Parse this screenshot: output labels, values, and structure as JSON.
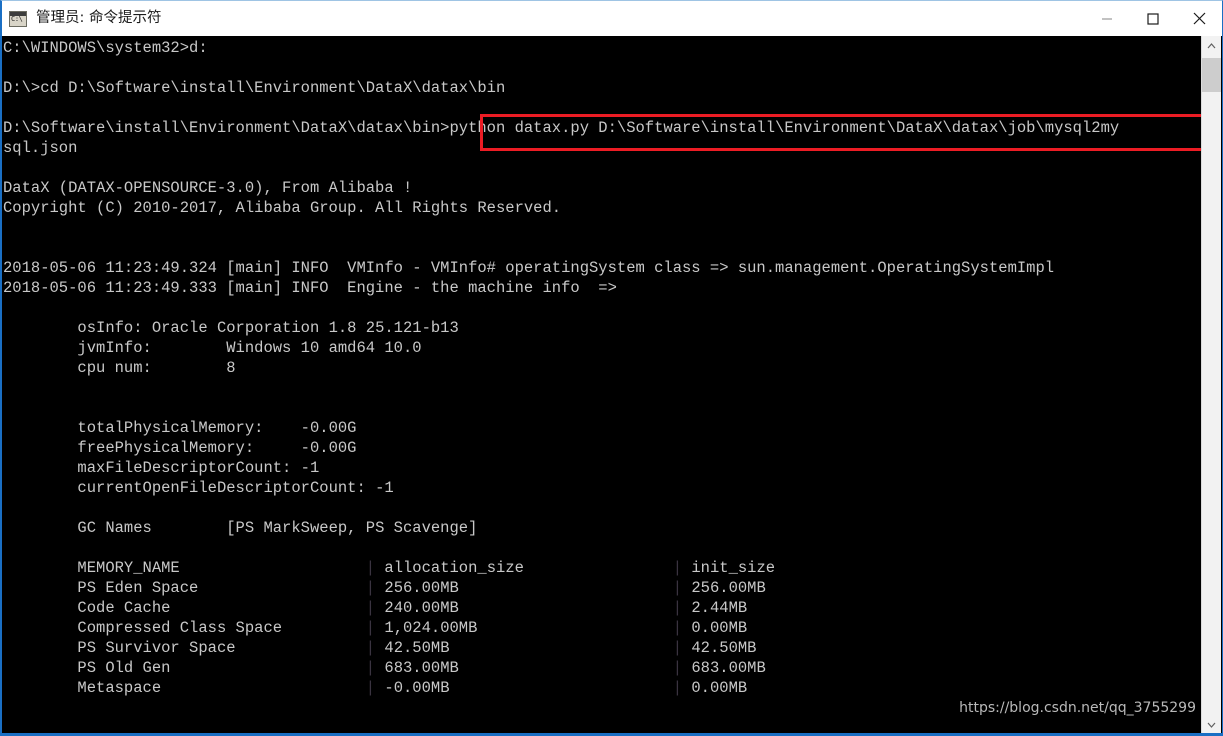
{
  "window": {
    "title": "管理员: 命令提示符",
    "icon": "console-icon",
    "icon_glyph": "C:\\",
    "controls": [
      {
        "name": "minimize",
        "label": "—"
      },
      {
        "name": "maximize",
        "label": "□"
      },
      {
        "name": "close",
        "label": "✕"
      }
    ]
  },
  "terminal": {
    "console_text": "C:\\WINDOWS\\system32>d:\n\nD:\\>cd D:\\Software\\install\\Environment\\DataX\\datax\\bin\n\nD:\\Software\\install\\Environment\\DataX\\datax\\bin>python datax.py D:\\Software\\install\\Environment\\DataX\\datax\\job\\mysql2my\nsql.json\n\nDataX (DATAX-OPENSOURCE-3.0), From Alibaba !\nCopyright (C) 2010-2017, Alibaba Group. All Rights Reserved.\n\n\n2018-05-06 11:23:49.324 [main] INFO  VMInfo - VMInfo# operatingSystem class => sun.management.OperatingSystemImpl\n2018-05-06 11:23:49.333 [main] INFO  Engine - the machine info  =>\n\n\tosInfo: Oracle Corporation 1.8 25.121-b13\n\tjvmInfo:        Windows 10 amd64 10.0\n\tcpu num:        8\n\n\n\ttotalPhysicalMemory:    -0.00G\n\tfreePhysicalMemory:     -0.00G\n\tmaxFileDescriptorCount: -1\n\tcurrentOpenFileDescriptorCount: -1\n\n\tGC Names        [PS MarkSweep, PS Scavenge]\n\n\tMEMORY_NAME                    | allocation_size                | init_size\n\tPS Eden Space                  | 256.00MB                       | 256.00MB\n\tCode Cache                     | 240.00MB                       | 2.44MB\n\tCompressed Class Space         | 1,024.00MB                     | 0.00MB\n\tPS Survivor Space              | 42.50MB                        | 42.50MB\n\tPS Old Gen                     | 683.00MB                       | 683.00MB\n\tMetaspace                      | -0.00MB                        | 0.00MB\n",
    "lines": {
      "prompt_1": "C:\\WINDOWS\\system32>d:",
      "prompt_2": "D:\\>cd D:\\Software\\install\\Environment\\DataX\\datax\\bin",
      "prompt_3": "D:\\Software\\install\\Environment\\DataX\\datax\\bin>",
      "command": "python datax.py D:\\Software\\install\\Environment\\DataX\\datax\\job\\mysql2mysql.json",
      "banner_1": "DataX (DATAX-OPENSOURCE-3.0), From Alibaba !",
      "banner_2": "Copyright (C) 2010-2017, Alibaba Group. All Rights Reserved.",
      "log_1": "2018-05-06 11:23:49.324 [main] INFO  VMInfo - VMInfo# operatingSystem class => sun.management.OperatingSystemImpl",
      "log_2": "2018-05-06 11:23:49.333 [main] INFO  Engine - the machine info  =>"
    },
    "machine_info": {
      "osInfo": "Oracle Corporation 1.8 25.121-b13",
      "jvmInfo": "Windows 10 amd64 10.0",
      "cpu_num": "8",
      "totalPhysicalMemory": "-0.00G",
      "freePhysicalMemory": "-0.00G",
      "maxFileDescriptorCount": "-1",
      "currentOpenFileDescriptorCount": "-1",
      "gc_names": "[PS MarkSweep, PS Scavenge]"
    },
    "memory_table": {
      "headers": [
        "MEMORY_NAME",
        "allocation_size",
        "init_size"
      ],
      "rows": [
        [
          "PS Eden Space",
          "256.00MB",
          "256.00MB"
        ],
        [
          "Code Cache",
          "240.00MB",
          "2.44MB"
        ],
        [
          "Compressed Class Space",
          "1,024.00MB",
          "0.00MB"
        ],
        [
          "PS Survivor Space",
          "42.50MB",
          "42.50MB"
        ],
        [
          "PS Old Gen",
          "683.00MB",
          "683.00MB"
        ],
        [
          "Metaspace",
          "-0.00MB",
          "0.00MB"
        ]
      ]
    }
  },
  "annotation": {
    "red_box_target": "python datax.py D:\\Software\\install\\Environment\\DataX\\datax\\job\\mysql2my",
    "red_box_color": "#ec1c24"
  },
  "watermark": {
    "text": "https://blog.csdn.net/qq_3755299"
  },
  "scrollbar": {
    "up_arrow": "chevron-up-icon",
    "down_arrow": "chevron-down-icon"
  },
  "colors": {
    "window_border": "#1a6fc4",
    "terminal_bg": "#000000",
    "terminal_fg": "#c8c8c8",
    "titlebar_bg": "#ffffff",
    "accent_red": "#ec1c24"
  }
}
